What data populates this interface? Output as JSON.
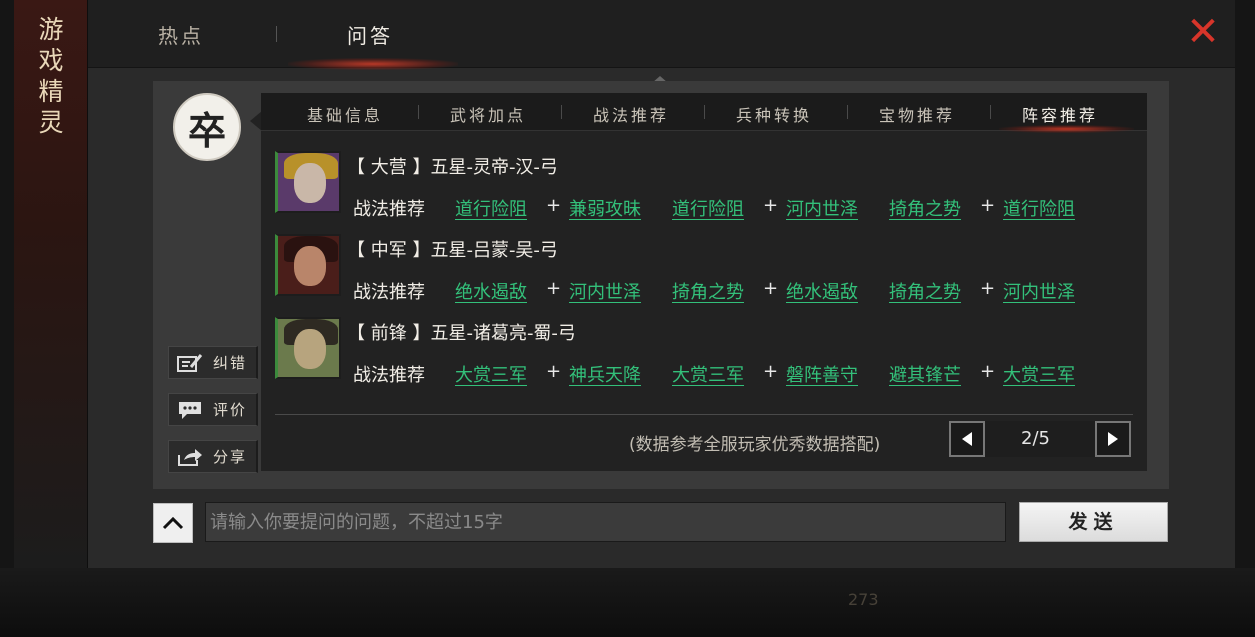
{
  "sidebar": {
    "title": "游戏精灵"
  },
  "top_tabs": [
    {
      "label": "热点",
      "active": false
    },
    {
      "label": "问答",
      "active": true
    }
  ],
  "close_icon": "close-x-icon",
  "avatar": {
    "glyph": "卒"
  },
  "sub_tabs": [
    {
      "label": "基础信息",
      "active": false
    },
    {
      "label": "武将加点",
      "active": false
    },
    {
      "label": "战法推荐",
      "active": false
    },
    {
      "label": "兵种转换",
      "active": false
    },
    {
      "label": "宝物推荐",
      "active": false
    },
    {
      "label": "阵容推荐",
      "active": true
    }
  ],
  "lineups": [
    {
      "title": "【 大营 】五星-灵帝-汉-弓",
      "rec_label": "战法推荐",
      "skills": [
        "道行险阻",
        "兼弱攻昧",
        "道行险阻",
        "河内世泽",
        "掎角之势",
        "道行险阻"
      ]
    },
    {
      "title": "【 中军 】五星-吕蒙-吴-弓",
      "rec_label": "战法推荐",
      "skills": [
        "绝水遏敌",
        "河内世泽",
        "掎角之势",
        "绝水遏敌",
        "掎角之势",
        "河内世泽"
      ]
    },
    {
      "title": "【 前锋 】五星-诸葛亮-蜀-弓",
      "rec_label": "战法推荐",
      "skills": [
        "大赏三军",
        "神兵天降",
        "大赏三军",
        "磐阵善守",
        "避其锋芒",
        "大赏三军"
      ]
    }
  ],
  "plus_sign": "+",
  "note": "(数据参考全服玩家优秀数据搭配)",
  "pagination": {
    "current": "2/5"
  },
  "side_buttons": [
    {
      "label": "纠错",
      "icon": "edit-icon"
    },
    {
      "label": "评价",
      "icon": "comment-icon"
    },
    {
      "label": "分享",
      "icon": "share-icon"
    }
  ],
  "input": {
    "placeholder": "请输入你要提问的问题，不超过15字",
    "value": ""
  },
  "send_label": "发送",
  "bottom_bar": {
    "count": "273"
  },
  "colors": {
    "skill_link": "#33c07a",
    "close": "#d7352a",
    "accent_glow": "#cd3723"
  }
}
